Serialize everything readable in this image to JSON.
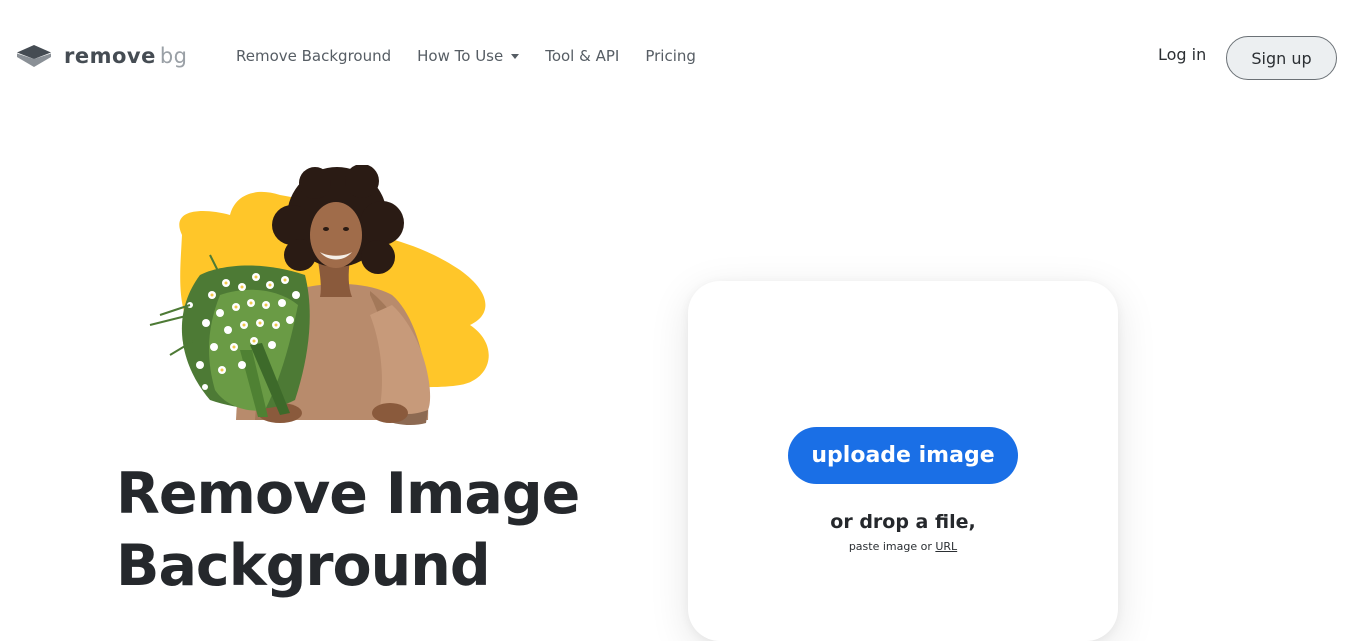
{
  "brand": {
    "name_main": "remove",
    "name_suffix": "bg",
    "icon": "layers-logo-icon"
  },
  "nav": {
    "items": [
      {
        "label": "Remove Background"
      },
      {
        "label": "How To Use",
        "icon": "chevron-down-icon"
      },
      {
        "label": "Tool & API"
      },
      {
        "label": "Pricing"
      }
    ],
    "login_label": "Log in",
    "signup_label": "Sign up"
  },
  "hero": {
    "title_line1": "Remove Image",
    "title_line2": "Background",
    "image": "woman-with-flower-bouquet-on-yellow-shape"
  },
  "upload": {
    "button_label": "uploade image",
    "drop_text": "or drop a file,",
    "paste_prefix": "paste image or ",
    "url_link": "URL"
  },
  "colors": {
    "accent_blue": "#1a6fe6",
    "blob_yellow": "#ffc629",
    "title_dark": "#25282c",
    "signup_bg": "#eceff1"
  }
}
